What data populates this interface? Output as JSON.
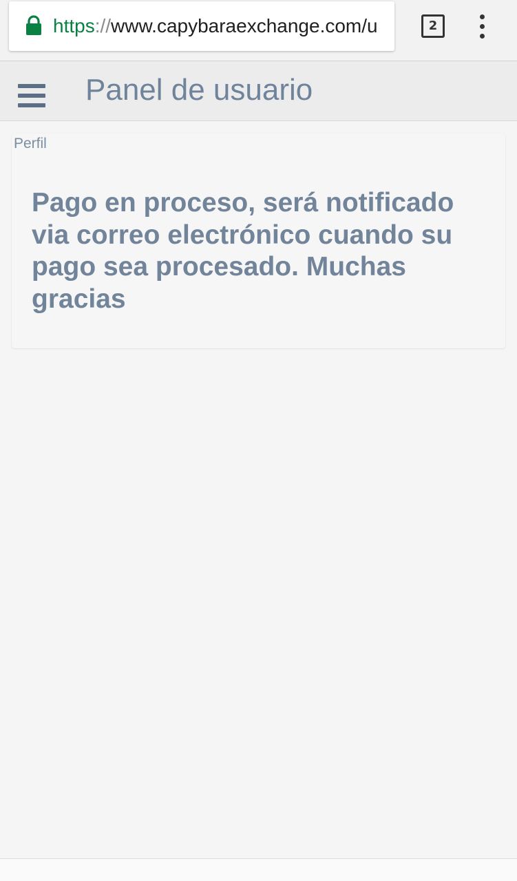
{
  "browser": {
    "url_scheme": "https",
    "url_separator": "://",
    "url_host": "www.capybaraexchange.com/u",
    "tab_count": "2",
    "lock_icon": "lock-icon",
    "overflow_icon": "vertical-dots-icon",
    "secure_color": "#0b8043"
  },
  "header": {
    "title": "Panel de usuario",
    "menu_icon": "hamburger-menu-icon"
  },
  "content": {
    "breadcrumb": "Perfil",
    "message": "Pago en proceso, será notificado via correo electrónico cuando su pago sea procesado. Muchas gracias"
  },
  "colors": {
    "text_accent": "#71849a",
    "header_bg": "#ececec",
    "page_bg": "#f5f5f5"
  }
}
